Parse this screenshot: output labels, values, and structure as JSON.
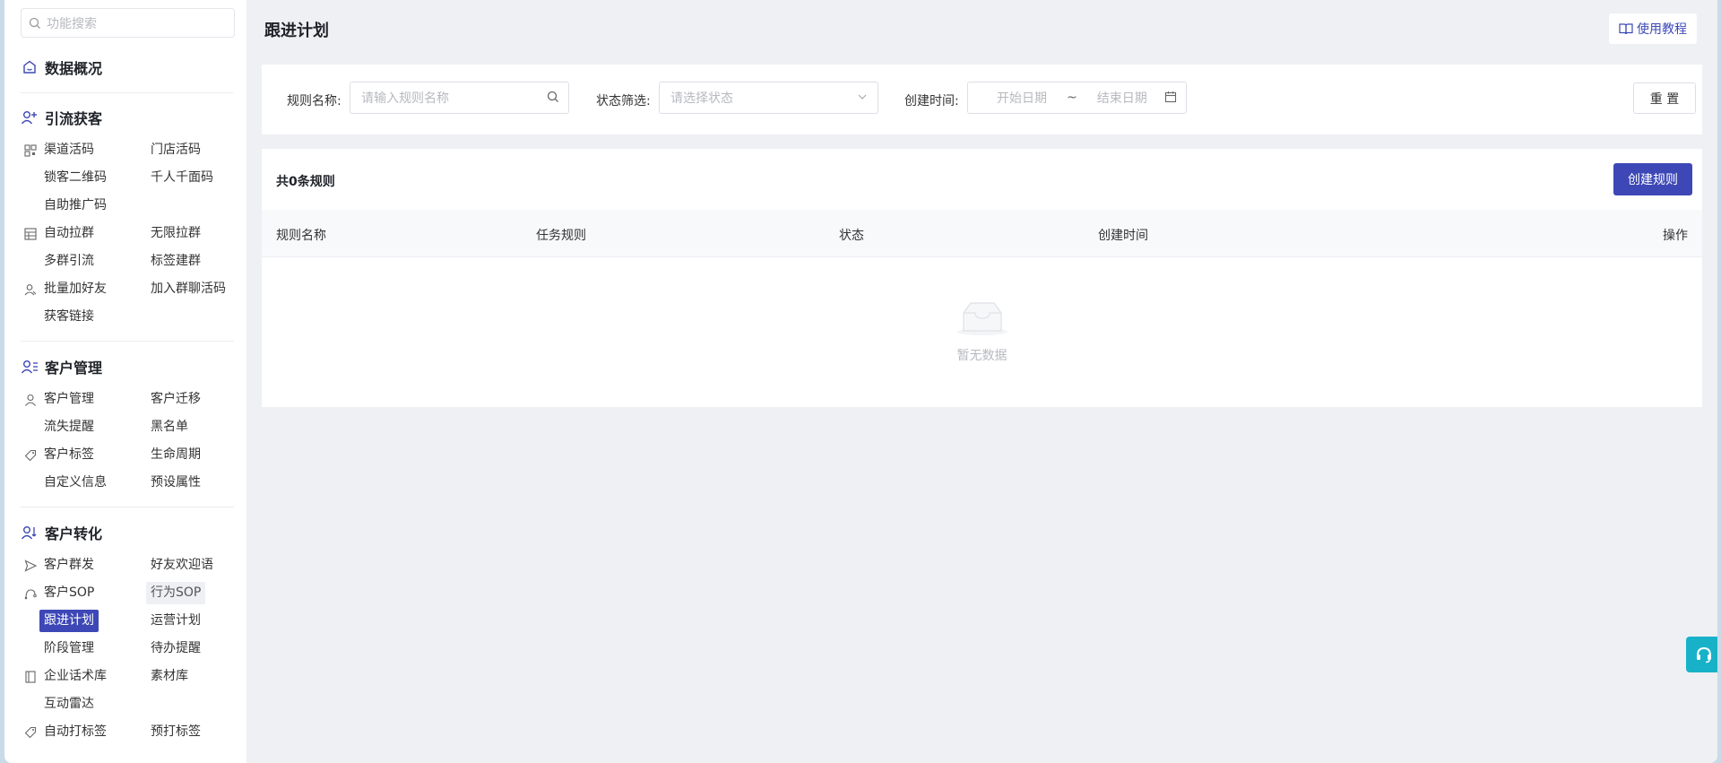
{
  "sidebar": {
    "search_placeholder": "功能搜索",
    "sections": [
      {
        "title": "数据概况",
        "icon": "dashboard-icon"
      },
      {
        "title": "引流获客",
        "icon": "add-user-icon"
      },
      {
        "title": "客户管理",
        "icon": "users-list-icon"
      },
      {
        "title": "客户转化",
        "icon": "user-convert-icon"
      }
    ],
    "items": {
      "qudao_huoma": "渠道活码",
      "mendian_huoma": "门店活码",
      "suoke_erweima": "锁客二维码",
      "qianren_qianmian": "千人千面码",
      "zizhu_tuiguang": "自助推广码",
      "zidong_laqun": "自动拉群",
      "wuxian_laqun": "无限拉群",
      "duoqun_yinliu": "多群引流",
      "biaoqian_jianqun": "标签建群",
      "piliang_haoyou": "批量加好友",
      "jiaru_qunliao": "加入群聊活码",
      "huoke_lianjie": "获客链接",
      "kehu_guanli": "客户管理",
      "kehu_qianyi": "客户迁移",
      "liushi_tixing": "流失提醒",
      "heimingdan": "黑名单",
      "kehu_biaoqian": "客户标签",
      "shengming_zhouqi": "生命周期",
      "zidingyi_xinxi": "自定义信息",
      "yushe_shuxing": "预设属性",
      "kehu_qunfa": "客户群发",
      "haoyou_huanying": "好友欢迎语",
      "kehu_sop": "客户SOP",
      "xingwei_sop": "行为SOP",
      "genjin_jihua": "跟进计划",
      "yunying_jihua": "运营计划",
      "jieduan_guanli": "阶段管理",
      "daiban_tixing": "待办提醒",
      "qiye_huashu": "企业话术库",
      "sucai_ku": "素材库",
      "hudong_leida": "互动雷达",
      "zidong_dabiaoqian": "自动打标签",
      "yu_dabiaoqian": "预打标签"
    }
  },
  "header": {
    "title": "跟进计划",
    "tutorial_label": "使用教程"
  },
  "filters": {
    "rule_name_label": "规则名称:",
    "rule_name_placeholder": "请输入规则名称",
    "status_label": "状态筛选:",
    "status_placeholder": "请选择状态",
    "created_label": "创建时间:",
    "start_placeholder": "开始日期",
    "range_sep": "~",
    "end_placeholder": "结束日期",
    "reset_label": "重 置"
  },
  "table": {
    "count_text": "共0条规则",
    "create_label": "创建规则",
    "columns": [
      "规则名称",
      "任务规则",
      "状态",
      "创建时间",
      "操作"
    ],
    "empty_text": "暂无数据"
  },
  "colors": {
    "primary": "#3d48b6",
    "help_button": "#18b2c8"
  }
}
